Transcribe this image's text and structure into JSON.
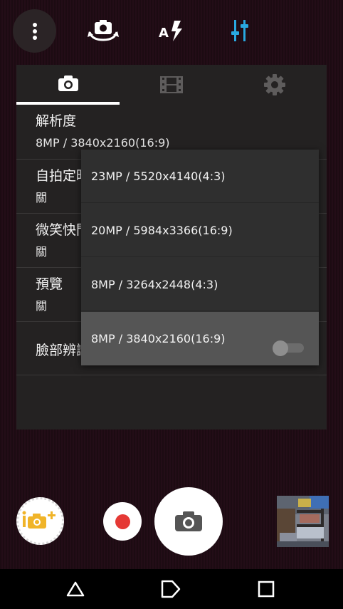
{
  "colors": {
    "accent": "#29a8e0",
    "flash_icon": "#ffffff",
    "record": "#e53935",
    "smart_badge": "#f0b429",
    "panel_bg": "#242222",
    "dropdown_bg": "#2f2f2f",
    "selected_option_bg": "#555555"
  },
  "top_bar": {
    "icons": [
      "more-vert-icon",
      "switch-camera-icon",
      "auto-flash-icon",
      "manual-settings-icon"
    ]
  },
  "settings_panel": {
    "tabs": [
      {
        "icon": "camera-icon",
        "active": true
      },
      {
        "icon": "video-icon",
        "active": false
      },
      {
        "icon": "gear-icon",
        "active": false
      }
    ],
    "items": [
      {
        "label": "解析度",
        "value": "8MP / 3840x2160(16:9)"
      },
      {
        "label": "自拍定時器",
        "value": "關"
      },
      {
        "label": "微笑快門",
        "value": "關"
      },
      {
        "label": "預覽",
        "value": "關"
      },
      {
        "label": "臉部辨識",
        "value": "",
        "toggle_on": false
      }
    ]
  },
  "resolution_dropdown": {
    "options": [
      {
        "label": "23MP / 5520x4140(4:3)",
        "selected": false
      },
      {
        "label": "20MP / 5984x3366(16:9)",
        "selected": false
      },
      {
        "label": "8MP / 3264x2448(4:3)",
        "selected": false
      },
      {
        "label": "8MP / 3840x2160(16:9)",
        "selected": true
      }
    ]
  },
  "bottom_controls": {
    "smart_mode_icon": "smart-auto-icon",
    "record_icon": "record-icon",
    "shutter_icon": "camera-icon",
    "thumbnail": "last-photo-thumbnail"
  },
  "nav_bar": {
    "icons": [
      "back-triangle-icon",
      "home-icon",
      "recents-square-icon"
    ]
  }
}
